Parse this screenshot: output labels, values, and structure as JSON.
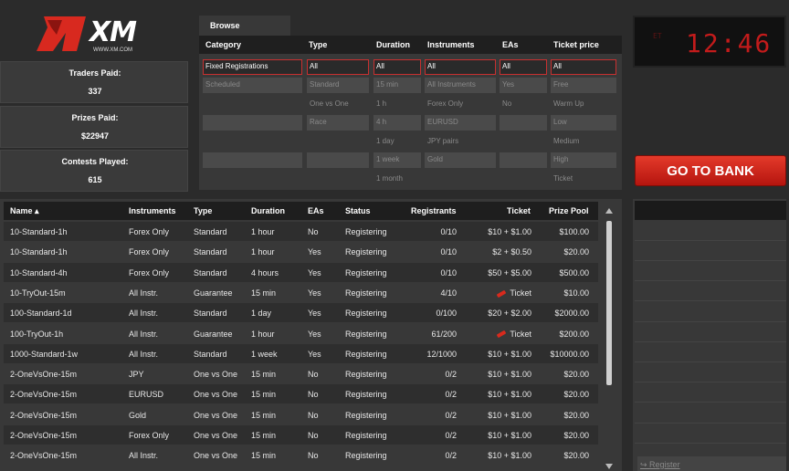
{
  "logo": {
    "text": "XM",
    "url": "WWW.XM.COM"
  },
  "stats": [
    {
      "label": "Traders Paid:",
      "value": "337"
    },
    {
      "label": "Prizes Paid:",
      "value": "$22947"
    },
    {
      "label": "Contests Played:",
      "value": "615"
    }
  ],
  "browse": {
    "tab_label": "Browse",
    "headers": {
      "category": "Category",
      "type": "Type",
      "duration": "Duration",
      "instruments": "Instruments",
      "eas": "EAs",
      "ticket_price": "Ticket price"
    },
    "category": [
      "Fixed Registrations",
      "Scheduled"
    ],
    "type": [
      "All",
      "Standard",
      "One vs One",
      "Race"
    ],
    "duration": [
      "All",
      "15 min",
      "1 h",
      "4 h",
      "1 day",
      "1 week",
      "1 month"
    ],
    "instruments": [
      "All",
      "All Instruments",
      "Forex Only",
      "EURUSD",
      "JPY pairs",
      "Gold"
    ],
    "eas": [
      "All",
      "Yes",
      "No"
    ],
    "ticket_price": [
      "All",
      "Free",
      "Warm Up",
      "Low",
      "Medium",
      "High",
      "Ticket"
    ]
  },
  "clock": {
    "label": "ET",
    "time": "12:46"
  },
  "bank_button": "GO TO BANK",
  "register_link": "Register",
  "table": {
    "headers": {
      "name": "Name ▴",
      "instruments": "Instruments",
      "type": "Type",
      "duration": "Duration",
      "eas": "EAs",
      "status": "Status",
      "registrants": "Registrants",
      "ticket": "Ticket",
      "prize_pool": "Prize Pool"
    },
    "rows": [
      {
        "name": "10-Standard-1h",
        "instruments": "Forex Only",
        "type": "Standard",
        "duration": "1 hour",
        "eas": "No",
        "status": "Registering",
        "registrants": "0/10",
        "ticket": "$10 + $1.00",
        "prize": "$100.00"
      },
      {
        "name": "10-Standard-1h",
        "instruments": "Forex Only",
        "type": "Standard",
        "duration": "1 hour",
        "eas": "Yes",
        "status": "Registering",
        "registrants": "0/10",
        "ticket": "$2 + $0.50",
        "prize": "$20.00"
      },
      {
        "name": "10-Standard-4h",
        "instruments": "Forex Only",
        "type": "Standard",
        "duration": "4 hours",
        "eas": "Yes",
        "status": "Registering",
        "registrants": "0/10",
        "ticket": "$50 + $5.00",
        "prize": "$500.00"
      },
      {
        "name": "10-TryOut-15m",
        "instruments": "All Instr.",
        "type": "Guarantee",
        "duration": "15 min",
        "eas": "Yes",
        "status": "Registering",
        "registrants": "4/10",
        "ticket": "Ticket",
        "prize": "$10.00"
      },
      {
        "name": "100-Standard-1d",
        "instruments": "All Instr.",
        "type": "Standard",
        "duration": "1 day",
        "eas": "Yes",
        "status": "Registering",
        "registrants": "0/100",
        "ticket": "$20 + $2.00",
        "prize": "$2000.00"
      },
      {
        "name": "100-TryOut-1h",
        "instruments": "All Instr.",
        "type": "Guarantee",
        "duration": "1 hour",
        "eas": "Yes",
        "status": "Registering",
        "registrants": "61/200",
        "ticket": "Ticket",
        "prize": "$200.00"
      },
      {
        "name": "1000-Standard-1w",
        "instruments": "All Instr.",
        "type": "Standard",
        "duration": "1 week",
        "eas": "Yes",
        "status": "Registering",
        "registrants": "12/1000",
        "ticket": "$10 + $1.00",
        "prize": "$10000.00"
      },
      {
        "name": "2-OneVsOne-15m",
        "instruments": "JPY",
        "type": "One vs One",
        "duration": "15 min",
        "eas": "No",
        "status": "Registering",
        "registrants": "0/2",
        "ticket": "$10 + $1.00",
        "prize": "$20.00"
      },
      {
        "name": "2-OneVsOne-15m",
        "instruments": "EURUSD",
        "type": "One vs One",
        "duration": "15 min",
        "eas": "No",
        "status": "Registering",
        "registrants": "0/2",
        "ticket": "$10 + $1.00",
        "prize": "$20.00"
      },
      {
        "name": "2-OneVsOne-15m",
        "instruments": "Gold",
        "type": "One vs One",
        "duration": "15 min",
        "eas": "No",
        "status": "Registering",
        "registrants": "0/2",
        "ticket": "$10 + $1.00",
        "prize": "$20.00"
      },
      {
        "name": "2-OneVsOne-15m",
        "instruments": "Forex Only",
        "type": "One vs One",
        "duration": "15 min",
        "eas": "No",
        "status": "Registering",
        "registrants": "0/2",
        "ticket": "$10 + $1.00",
        "prize": "$20.00"
      },
      {
        "name": "2-OneVsOne-15m",
        "instruments": "All Instr.",
        "type": "One vs One",
        "duration": "15 min",
        "eas": "No",
        "status": "Registering",
        "registrants": "0/2",
        "ticket": "$10 + $1.00",
        "prize": "$20.00"
      }
    ]
  }
}
